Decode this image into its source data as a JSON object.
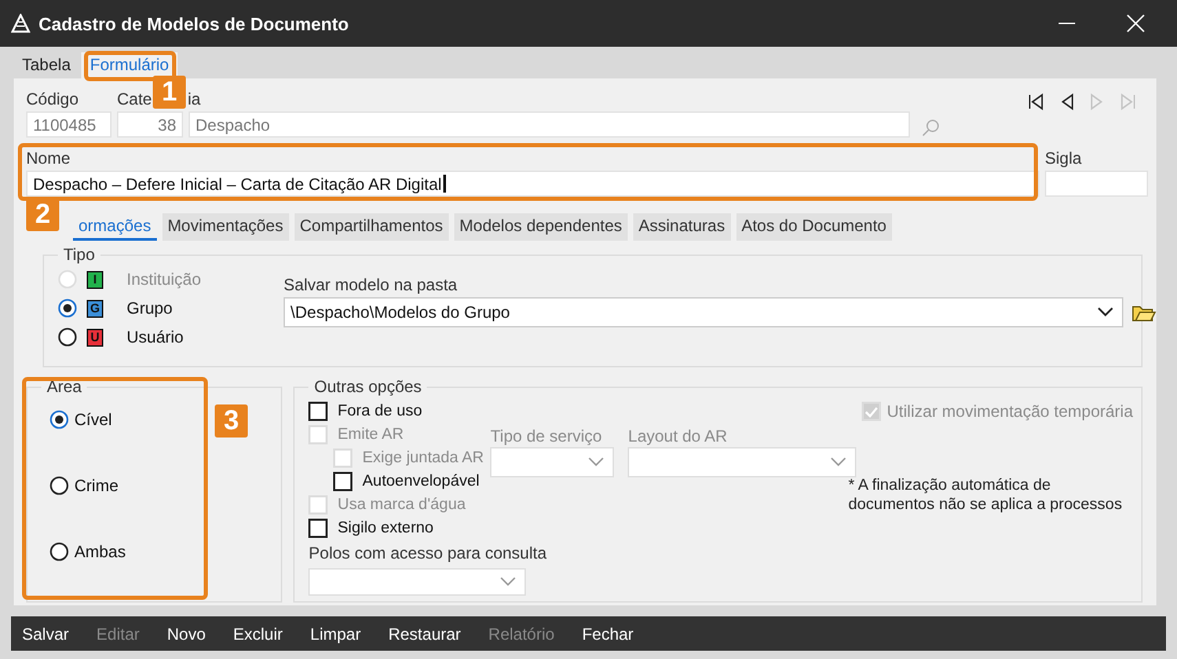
{
  "window": {
    "title": "Cadastro de Modelos de Documento"
  },
  "tabs": [
    {
      "label": "Tabela",
      "selected": false
    },
    {
      "label": "Formulário",
      "selected": true
    }
  ],
  "record": {
    "codigo_label": "Código",
    "codigo": "1100485",
    "categoria_label_parts": [
      "Cate",
      "ia"
    ],
    "categoria_code": "38",
    "categoria_name": "Despacho",
    "nome_label": "Nome",
    "nome": "Despacho – Defere Inicial – Carta de Citação AR Digital",
    "sigla_label": "Sigla"
  },
  "nav_buttons": [
    {
      "kind": "first",
      "disabled": false
    },
    {
      "kind": "prev",
      "disabled": false
    },
    {
      "kind": "next",
      "disabled": true
    },
    {
      "kind": "last",
      "disabled": true
    }
  ],
  "subtabs": [
    {
      "label": "ormações",
      "selected": true
    },
    {
      "label": "Movimentações",
      "selected": false
    },
    {
      "label": "Compartilhamentos",
      "selected": false
    },
    {
      "label": "Modelos dependentes",
      "selected": false
    },
    {
      "label": "Assinaturas",
      "selected": false
    },
    {
      "label": "Atos do Documento",
      "selected": false
    }
  ],
  "tipo": {
    "title": "Tipo",
    "options": [
      {
        "label": "Instituição",
        "letter": "I",
        "color": "#22b24c",
        "selected": false,
        "disabled": true
      },
      {
        "label": "Grupo",
        "letter": "G",
        "color": "#3b8fd9",
        "selected": true,
        "disabled": false
      },
      {
        "label": "Usuário",
        "letter": "U",
        "color": "#e8303a",
        "selected": false,
        "disabled": false
      }
    ]
  },
  "pasta": {
    "label": "Salvar modelo na pasta",
    "value": "\\Despacho\\Modelos do Grupo"
  },
  "area": {
    "title": "Area",
    "options": [
      {
        "label": "Cível",
        "selected": true
      },
      {
        "label": "Crime",
        "selected": false
      },
      {
        "label": "Ambas",
        "selected": false
      }
    ]
  },
  "outras": {
    "title": "Outras opções",
    "checks": [
      {
        "label": "Fora de uso",
        "checked": false,
        "disabled": false
      },
      {
        "label": "Emite AR",
        "checked": false,
        "disabled": true,
        "children": [
          {
            "label": "Exige juntada AR",
            "checked": false,
            "disabled": true
          },
          {
            "label": "Autoenvelopável",
            "checked": false,
            "disabled": false
          }
        ]
      },
      {
        "label": "Usa marca d'água",
        "checked": false,
        "disabled": true
      },
      {
        "label": "Sigilo externo",
        "checked": false,
        "disabled": false
      }
    ],
    "tipo_servico_label": "Tipo de serviço",
    "layout_ar_label": "Layout do AR",
    "polos_label": "Polos com acesso para consulta",
    "temporaria": {
      "label": "Utilizar movimentação temporária",
      "checked": true,
      "disabled": true
    },
    "note": "* A finalização automática de documentos não se aplica a processos"
  },
  "toolbar": [
    {
      "label": "Salvar",
      "disabled": false
    },
    {
      "label": "Editar",
      "disabled": true
    },
    {
      "label": "Novo",
      "disabled": false
    },
    {
      "label": "Excluir",
      "disabled": false
    },
    {
      "label": "Limpar",
      "disabled": false
    },
    {
      "label": "Restaurar",
      "disabled": false
    },
    {
      "label": "Relatório",
      "disabled": true
    },
    {
      "label": "Fechar",
      "disabled": false
    }
  ],
  "annotations": [
    {
      "number": "1"
    },
    {
      "number": "2"
    },
    {
      "number": "3"
    }
  ]
}
